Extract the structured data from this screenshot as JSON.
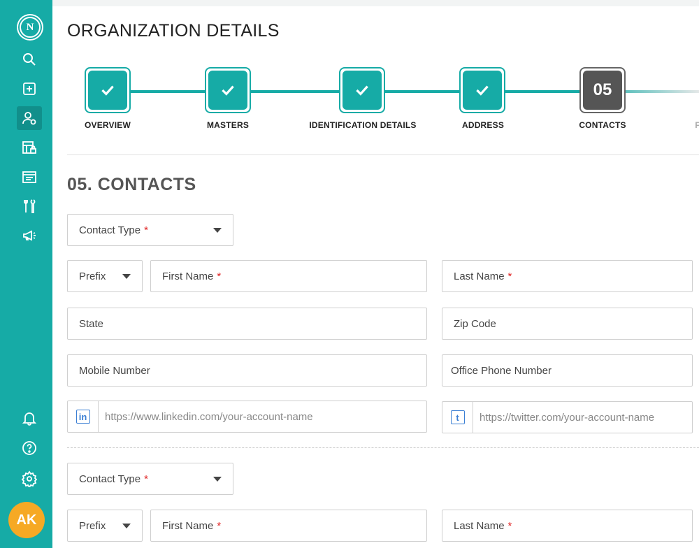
{
  "sidebar": {
    "logo_text": "N",
    "active_item": "organization",
    "nav": [
      "search-icon",
      "add-icon",
      "user-settings-icon",
      "building-lock-icon",
      "folder-icon",
      "tools-icon",
      "megaphone-icon"
    ],
    "bottom": [
      "bell-icon",
      "help-icon",
      "settings-gear-icon"
    ],
    "avatar_initials": "AK",
    "colors": {
      "background": "#16aba6",
      "avatar": "#f6a924"
    }
  },
  "page": {
    "title": "ORGANIZATION DETAILS"
  },
  "stepper": {
    "steps": [
      {
        "label": "OVERVIEW",
        "status": "done"
      },
      {
        "label": "MASTERS",
        "status": "done"
      },
      {
        "label": "IDENTIFICATION DETAILS",
        "status": "done"
      },
      {
        "label": "ADDRESS",
        "status": "done"
      },
      {
        "label": "CONTACTS",
        "status": "current",
        "number": "05"
      },
      {
        "label": "F",
        "status": "upcoming"
      }
    ]
  },
  "section": {
    "title": "05. CONTACTS"
  },
  "contacts": [
    {
      "contact_type": {
        "label": "Contact Type",
        "required": "*"
      },
      "prefix": {
        "label": "Prefix"
      },
      "first_name": {
        "label": "First Name",
        "required": "*"
      },
      "last_name": {
        "label": "Last Name",
        "required": "*"
      },
      "state": {
        "label": "State"
      },
      "zip_code": {
        "label": "Zip Code"
      },
      "mobile": {
        "label": "Mobile Number"
      },
      "office_phone": {
        "label": "Office Phone Number"
      },
      "linkedin": {
        "icon": "in",
        "placeholder": "https://www.linkedin.com/your-account-name"
      },
      "twitter": {
        "icon": "t",
        "placeholder": "https://twitter.com/your-account-name"
      }
    },
    {
      "contact_type": {
        "label": "Contact Type",
        "required": "*"
      },
      "prefix": {
        "label": "Prefix"
      },
      "first_name": {
        "label": "First Name",
        "required": "*"
      },
      "last_name": {
        "label": "Last Name",
        "required": "*"
      }
    }
  ]
}
